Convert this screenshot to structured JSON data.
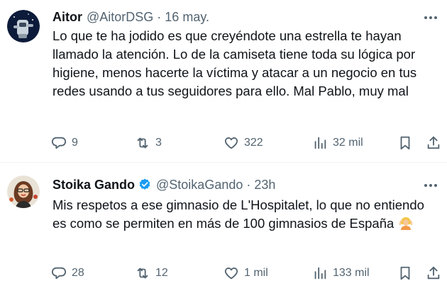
{
  "tweets": [
    {
      "display_name": "Aitor",
      "handle": "@AitorDSG",
      "separator": "·",
      "time": "16 may.",
      "verified": false,
      "avatar_icon": "robot-avatar",
      "text": "Lo que te ha jodido es que creyéndote una estrella te hayan llamado la atención. Lo de la camiseta tiene toda su lógica por higiene, menos hacerte la víctima y atacar a un negocio en tus redes usando a tus seguidores para ello. Mal Pablo, muy mal",
      "emoji": "",
      "stats": {
        "replies": "9",
        "retweets": "3",
        "likes": "322",
        "views": "32 mil"
      }
    },
    {
      "display_name": "Stoika Gando",
      "handle": "@StoikaGando",
      "separator": "·",
      "time": "23h",
      "verified": true,
      "avatar_icon": "woman-avatar",
      "text": "Mis respetos a ese gimnasio de L'Hospitalet, lo que no entiendo es como se permiten en más de 100 gimnasios de España",
      "emoji": "person-gesturing-ok-emoji",
      "stats": {
        "replies": "28",
        "retweets": "12",
        "likes": "1 mil",
        "views": "133 mil"
      }
    }
  ],
  "colors": {
    "text": "#0f1419",
    "secondary": "#536471",
    "verified": "#1d9bf0",
    "divider": "#eff3f4"
  },
  "icons": [
    "reply-icon",
    "retweet-icon",
    "like-icon",
    "views-icon",
    "bookmark-icon",
    "share-icon",
    "more-icon",
    "verified-icon"
  ]
}
